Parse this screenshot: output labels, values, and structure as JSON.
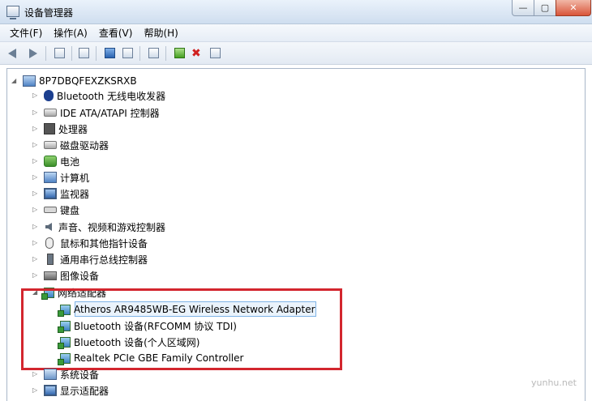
{
  "window": {
    "title": "设备管理器",
    "min_label": "—",
    "max_label": "▢",
    "close_label": "✕"
  },
  "menu": [
    "文件(F)",
    "操作(A)",
    "查看(V)",
    "帮助(H)"
  ],
  "tree": {
    "root": "8P7DBQFEXZKSRXB",
    "categories": [
      {
        "label": "Bluetooth 无线电收发器",
        "icon": "bluetooth-icon"
      },
      {
        "label": "IDE ATA/ATAPI 控制器",
        "icon": "ide-controller-icon"
      },
      {
        "label": "处理器",
        "icon": "processor-icon"
      },
      {
        "label": "磁盘驱动器",
        "icon": "disk-drive-icon"
      },
      {
        "label": "电池",
        "icon": "battery-icon"
      },
      {
        "label": "计算机",
        "icon": "computer-icon"
      },
      {
        "label": "监视器",
        "icon": "monitor-icon"
      },
      {
        "label": "键盘",
        "icon": "keyboard-icon"
      },
      {
        "label": "声音、视频和游戏控制器",
        "icon": "sound-icon"
      },
      {
        "label": "鼠标和其他指针设备",
        "icon": "mouse-icon"
      },
      {
        "label": "通用串行总线控制器",
        "icon": "usb-icon"
      },
      {
        "label": "图像设备",
        "icon": "imaging-device-icon"
      }
    ],
    "network": {
      "label": "网络适配器",
      "children": [
        "Atheros AR9485WB-EG Wireless Network Adapter",
        "Bluetooth 设备(RFCOMM 协议 TDI)",
        "Bluetooth 设备(个人区域网)",
        "Realtek PCIe GBE Family Controller"
      ]
    },
    "after": [
      {
        "label": "系统设备",
        "icon": "system-device-icon"
      },
      {
        "label": "显示适配器",
        "icon": "display-adapter-icon"
      }
    ]
  },
  "watermark": "yunhu.net"
}
